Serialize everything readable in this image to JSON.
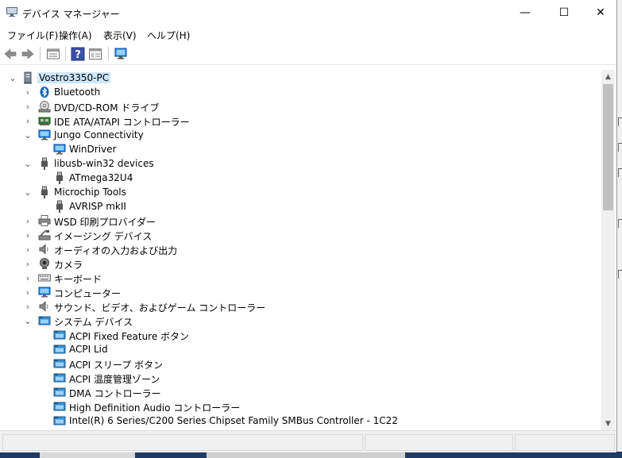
{
  "window": {
    "title": "デバイス マネージャー",
    "controls": {
      "minimize": "—",
      "maximize": "☐",
      "close": "✕"
    }
  },
  "menu": [
    {
      "label": "ファイル(F)"
    },
    {
      "label": "操作(A)"
    },
    {
      "label": "表示(V)"
    },
    {
      "label": "ヘルプ(H)"
    }
  ],
  "toolbar": {
    "icons": [
      "back-arrow-icon",
      "forward-arrow-icon",
      "properties-sheet-icon",
      "help-icon",
      "view-panel-icon",
      "computer-scan-icon"
    ]
  },
  "tree": {
    "root": "Vostro3350-PC",
    "items": [
      {
        "label": "Bluetooth",
        "icon": "bluetooth-icon",
        "state": "collapsed"
      },
      {
        "label": "DVD/CD-ROM ドライブ",
        "icon": "dvd-drive-icon",
        "state": "collapsed"
      },
      {
        "label": "IDE ATA/ATAPI コントローラー",
        "icon": "ide-controller-icon",
        "state": "collapsed"
      },
      {
        "label": "Jungo Connectivity",
        "icon": "monitor-icon",
        "state": "expanded"
      },
      {
        "label": "WinDriver",
        "icon": "monitor-icon",
        "state": "child"
      },
      {
        "label": "libusb-win32 devices",
        "icon": "usb-plug-icon",
        "state": "expanded"
      },
      {
        "label": "ATmega32U4",
        "icon": "usb-plug-icon",
        "state": "child"
      },
      {
        "label": "Microchip Tools",
        "icon": "usb-plug-icon",
        "state": "expanded"
      },
      {
        "label": "AVRISP mkII",
        "icon": "usb-plug-icon",
        "state": "child"
      },
      {
        "label": "WSD 印刷プロバイダー",
        "icon": "printer-icon",
        "state": "collapsed"
      },
      {
        "label": "イメージング デバイス",
        "icon": "camera-scanner-icon",
        "state": "collapsed"
      },
      {
        "label": "オーディオの入力および出力",
        "icon": "speaker-icon",
        "state": "collapsed"
      },
      {
        "label": "カメラ",
        "icon": "webcam-icon",
        "state": "collapsed"
      },
      {
        "label": "キーボード",
        "icon": "keyboard-icon",
        "state": "collapsed"
      },
      {
        "label": "コンピューター",
        "icon": "monitor-icon",
        "state": "collapsed"
      },
      {
        "label": "サウンド、ビデオ、およびゲーム コントローラー",
        "icon": "speaker-icon",
        "state": "collapsed"
      },
      {
        "label": "システム デバイス",
        "icon": "system-folder-icon",
        "state": "expanded"
      },
      {
        "label": "ACPI Fixed Feature ボタン",
        "icon": "system-folder-icon",
        "state": "child"
      },
      {
        "label": "ACPI Lid",
        "icon": "system-folder-icon",
        "state": "child"
      },
      {
        "label": "ACPI スリープ ボタン",
        "icon": "system-folder-icon",
        "state": "child"
      },
      {
        "label": "ACPI 温度管理ゾーン",
        "icon": "system-folder-icon",
        "state": "child"
      },
      {
        "label": "DMA コントローラー",
        "icon": "system-folder-icon",
        "state": "child"
      },
      {
        "label": "High Definition Audio コントローラー",
        "icon": "system-folder-icon",
        "state": "child"
      },
      {
        "label": "Intel(R) 6 Series/C200 Series Chipset Family SMBus Controller - 1C22",
        "icon": "system-folder-icon",
        "state": "child"
      }
    ]
  },
  "colors": {
    "selection": "#cce8ff",
    "monitor_blue": "#1e88e5",
    "bluetooth_blue": "#1565c0"
  }
}
